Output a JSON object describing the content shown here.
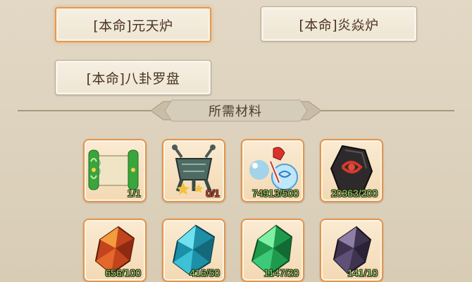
{
  "recipes": [
    {
      "label": "[本命]元天炉",
      "selected": true
    },
    {
      "label": "[本命]炎焱炉",
      "selected": false
    },
    {
      "label": "[本命]八卦罗盘",
      "selected": false
    }
  ],
  "materials_section": {
    "title": "所需材料"
  },
  "materials": [
    {
      "icon": "green-scroll-icon",
      "count": "1/1",
      "status": "ok"
    },
    {
      "icon": "bronze-cauldron-icon",
      "count": "0/1",
      "status": "lack"
    },
    {
      "icon": "spirit-charm-icon",
      "count": "74913/500",
      "status": "ok"
    },
    {
      "icon": "dark-rune-stone-icon",
      "count": "20363/200",
      "status": "ok"
    },
    {
      "icon": "fire-crystal-icon",
      "count": "656/100",
      "status": "ok"
    },
    {
      "icon": "ice-crystal-icon",
      "count": "416/50",
      "status": "ok"
    },
    {
      "icon": "jade-crystal-icon",
      "count": "1147/20",
      "status": "ok"
    },
    {
      "icon": "shadow-crystal-icon",
      "count": "141/10",
      "status": "ok"
    }
  ],
  "colors": {
    "selected_border": "#e3994f",
    "count_ok": "#8ee064",
    "count_lack": "#ff4a3a"
  }
}
